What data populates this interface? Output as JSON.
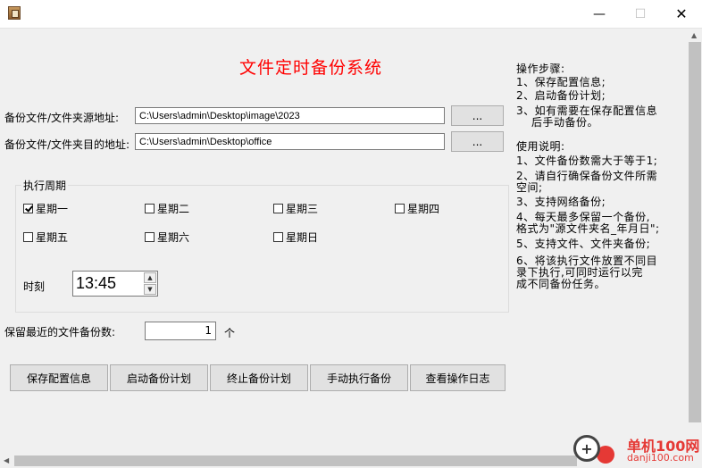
{
  "window": {
    "min_icon": "—",
    "max_icon": "☐",
    "close_icon": "✕"
  },
  "main": {
    "title": "文件定时备份系统",
    "source_label": "备份文件/文件夹源地址:",
    "source_value": "C:\\Users\\admin\\Desktop\\image\\2023",
    "dest_label": "备份文件/文件夹目的地址:",
    "dest_value": "C:\\Users\\admin\\Desktop\\office",
    "browse_label": "..."
  },
  "schedule": {
    "group_title": "执行周期",
    "days": [
      {
        "label": "星期一",
        "checked": true
      },
      {
        "label": "星期二",
        "checked": false
      },
      {
        "label": "星期三",
        "checked": false
      },
      {
        "label": "星期四",
        "checked": false
      },
      {
        "label": "星期五",
        "checked": false
      },
      {
        "label": "星期六",
        "checked": false
      },
      {
        "label": "星期日",
        "checked": false
      }
    ],
    "time_label": "时刻",
    "time_value": "13:45"
  },
  "retention": {
    "label": "保留最近的文件备份数:",
    "value": "1",
    "unit": "个"
  },
  "buttons": {
    "save": "保存配置信息",
    "start": "启动备份计划",
    "stop": "终止备份计划",
    "manual": "手动执行备份",
    "log": "查看操作日志"
  },
  "steps": {
    "heading": "操作步骤:",
    "line1": "1、保存配置信息;",
    "line2": "2、启动备份计划;",
    "line3a": "3、如有需要在保存配置信息",
    "line3b": "后手动备份。"
  },
  "usage": {
    "heading": "使用说明:",
    "line1": "1、文件备份数需大于等于1;",
    "line2a": "2、请自行确保备份文件所需",
    "line2b": "空间;",
    "line3": "3、支持网络备份;",
    "line4a": "4、每天最多保留一个备份,",
    "line4b": "格式为\"源文件夹名_年月日\";",
    "line5": "5、支持文件、文件夹备份;",
    "line6a": "6、将该执行文件放置不同目",
    "line6b": "录下执行,可同时运行以完",
    "line6c": "成不同备份任务。"
  },
  "watermark": {
    "site_cn": "单机100网",
    "site_url": "danji100.com"
  }
}
